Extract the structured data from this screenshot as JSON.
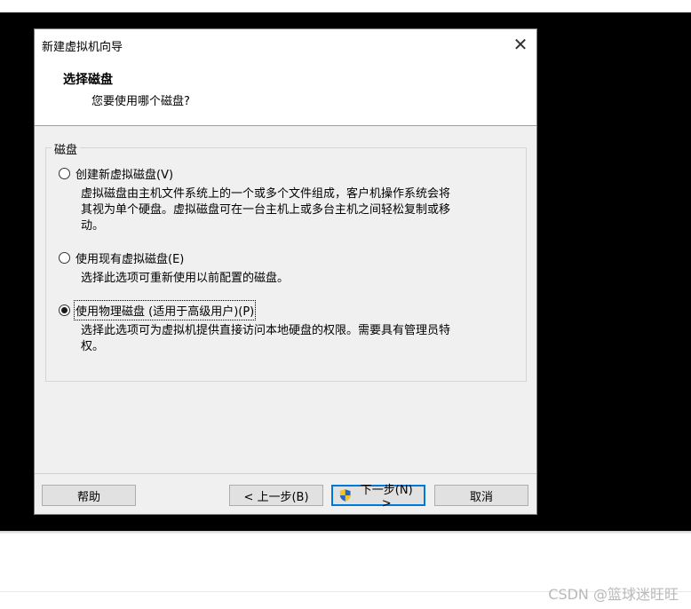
{
  "dialog": {
    "title": "新建虚拟机向导",
    "close_glyph": "✕",
    "heading": "选择磁盘",
    "subheading": "您要使用哪个磁盘?"
  },
  "disk_group": {
    "label": "磁盘",
    "options": [
      {
        "label": "创建新虚拟磁盘(V)",
        "checked": false,
        "description_lines": [
          "虚拟磁盘由主机文件系统上的一个或多个文件组成，客户机操作系统会将",
          "其视为单个硬盘。虚拟磁盘可在一台主机上或多台主机之间轻松复制或移",
          "动。"
        ]
      },
      {
        "label": "使用现有虚拟磁盘(E)",
        "checked": false,
        "description_lines": [
          "选择此选项可重新使用以前配置的磁盘。"
        ]
      },
      {
        "label": "使用物理磁盘 (适用于高级用户)(P)",
        "checked": true,
        "description_lines": [
          "选择此选项可为虚拟机提供直接访问本地硬盘的权限。需要具有管理员特",
          "权。"
        ]
      }
    ]
  },
  "buttons": {
    "help": "帮助",
    "back": "< 上一步(B)",
    "next": "下一步(N) >",
    "cancel": "取消"
  },
  "watermark": "CSDN @篮球迷旺旺",
  "colors": {
    "accent": "#0078d7",
    "shield_blue": "#2563c9",
    "shield_yellow": "#f5c518"
  }
}
